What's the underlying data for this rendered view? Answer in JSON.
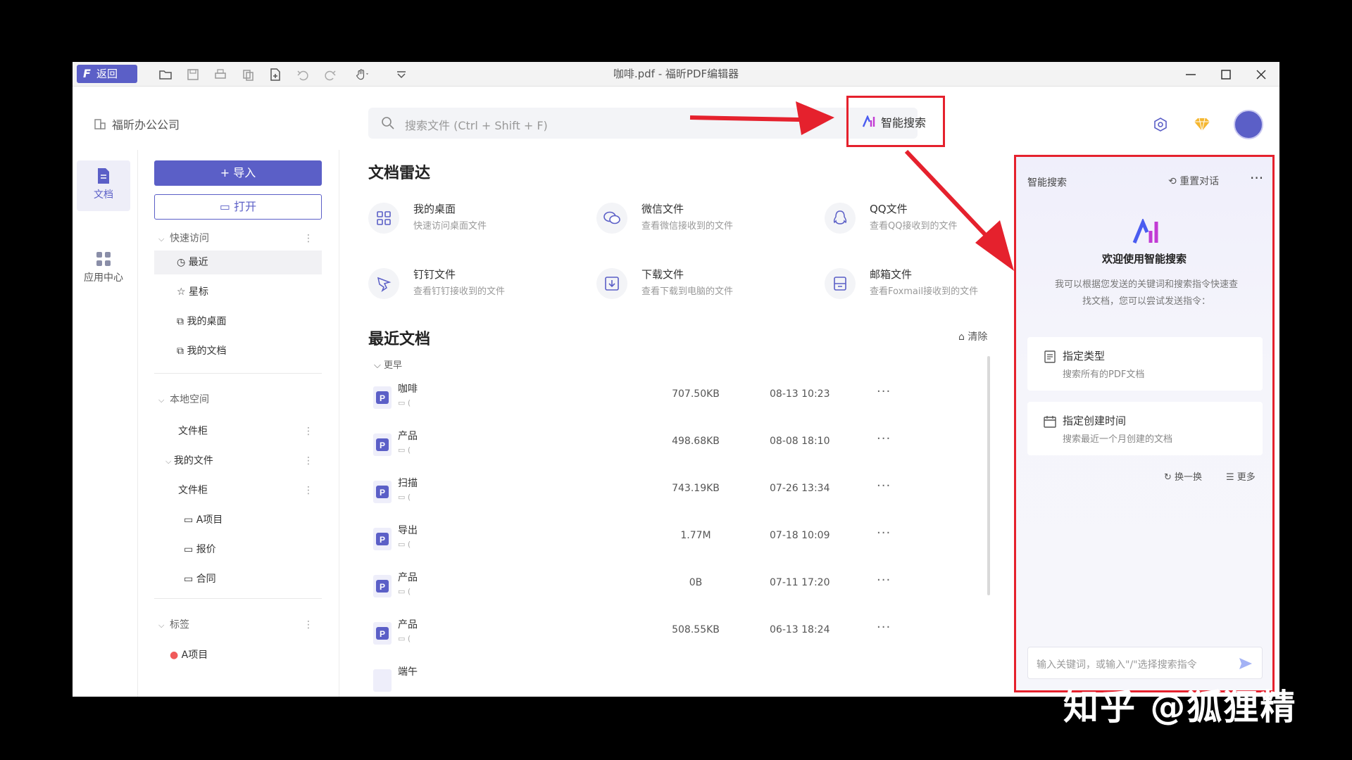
{
  "titlebar": {
    "back_label": "返回",
    "window_title": "咖啡.pdf - 福昕PDF编辑器"
  },
  "header": {
    "company": "福昕办公公司",
    "search_placeholder": "搜索文件 (Ctrl + Shift + F)",
    "smart_search": "智能搜索"
  },
  "nav": {
    "docs": "文档",
    "apps": "应用中心"
  },
  "sidebar": {
    "import": "+ 导入",
    "open": "打开",
    "quick_access": "快速访问",
    "recent": "最近",
    "starred": "星标",
    "my_desktop": "我的桌面",
    "my_docs": "我的文档",
    "local_space": "本地空间",
    "cabinet1": "文件柜",
    "my_files": "我的文件",
    "cabinet2": "文件柜",
    "folder_a": "A项目",
    "folder_quote": "报价",
    "folder_contract": "合同",
    "tags": "标签",
    "tag_a": "A项目"
  },
  "main": {
    "radar_title": "文档雷达",
    "radar": [
      {
        "title": "我的桌面",
        "sub": "快速访问桌面文件"
      },
      {
        "title": "微信文件",
        "sub": "查看微信接收到的文件"
      },
      {
        "title": "QQ文件",
        "sub": "查看QQ接收到的文件"
      },
      {
        "title": "钉钉文件",
        "sub": "查看钉钉接收到的文件"
      },
      {
        "title": "下载文件",
        "sub": "查看下载到电脑的文件"
      },
      {
        "title": "邮箱文件",
        "sub": "查看Foxmail接收到的文件"
      }
    ],
    "recent_title": "最近文档",
    "clear": "清除",
    "earlier": "更早",
    "files": [
      {
        "name": "咖啡",
        "size": "707.50KB",
        "date": "08-13 10:23"
      },
      {
        "name": "产品",
        "size": "498.68KB",
        "date": "08-08 18:10"
      },
      {
        "name": "扫描",
        "size": "743.19KB",
        "date": "07-26 13:34"
      },
      {
        "name": "导出",
        "size": "1.77M",
        "date": "07-18 10:09"
      },
      {
        "name": "产品",
        "size": "0B",
        "date": "07-11 17:20"
      },
      {
        "name": "产品",
        "size": "508.55KB",
        "date": "06-13 18:24"
      },
      {
        "name": "端午",
        "size": "",
        "date": ""
      }
    ]
  },
  "panel": {
    "title": "智能搜索",
    "reset": "重置对话",
    "welcome": "欢迎使用智能搜索",
    "desc": "我可以根据您发送的关键词和搜索指令快速查找文档，您可以尝试发送指令：",
    "card1_title": "指定类型",
    "card1_sub": "搜索所有的PDF文档",
    "card2_title": "指定创建时间",
    "card2_sub": "搜索最近一个月创建的文档",
    "swap": "换一换",
    "more": "更多",
    "input_placeholder": "输入关键词，或输入\"/\"选择搜索指令"
  },
  "watermark": "知乎 @狐狸精",
  "colors": {
    "accent": "#5b5fc7",
    "highlight": "#e5212d"
  }
}
